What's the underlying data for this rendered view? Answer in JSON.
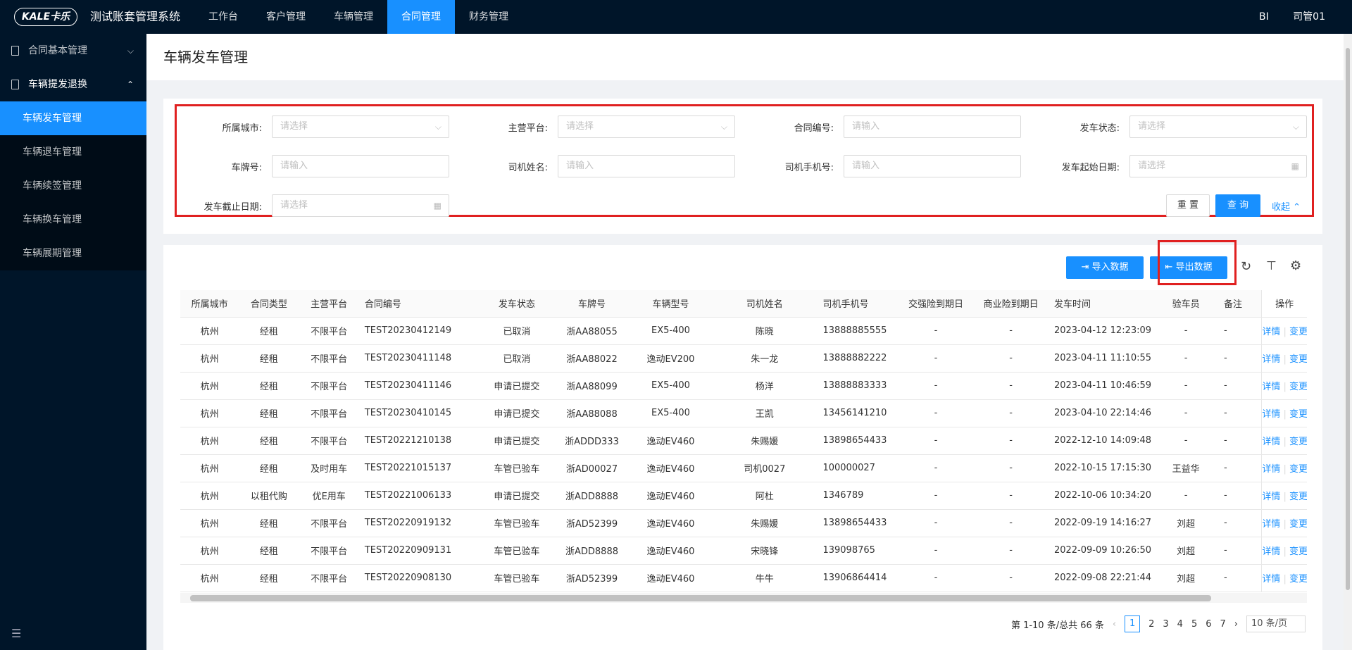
{
  "header": {
    "logo": "KALE卡乐",
    "app_title": "测试账套管理系统",
    "nav": [
      "工作台",
      "客户管理",
      "车辆管理",
      "合同管理",
      "财务管理"
    ],
    "bi": "BI",
    "user": "司管01"
  },
  "sidebar": {
    "group1": "合同基本管理",
    "group2": "车辆提发退换",
    "items": [
      "车辆发车管理",
      "车辆退车管理",
      "车辆续签管理",
      "车辆换车管理",
      "车辆展期管理"
    ]
  },
  "page": {
    "title": "车辆发车管理"
  },
  "filters": {
    "city_label": "所属城市:",
    "city_ph": "请选择",
    "platform_label": "主营平台:",
    "platform_ph": "请选择",
    "contract_label": "合同编号:",
    "contract_ph": "请输入",
    "status_label": "发车状态:",
    "status_ph": "请选择",
    "plate_label": "车牌号:",
    "plate_ph": "请输入",
    "driver_label": "司机姓名:",
    "driver_ph": "请输入",
    "phone_label": "司机手机号:",
    "phone_ph": "请输入",
    "start_label": "发车起始日期:",
    "start_ph": "请选择",
    "end_label": "发车截止日期:",
    "end_ph": "请选择",
    "reset": "重 置",
    "query": "查 询",
    "collapse": "收起"
  },
  "toolbar": {
    "import": "导入数据",
    "export": "导出数据"
  },
  "table": {
    "headers": [
      "所属城市",
      "合同类型",
      "主营平台",
      "合同编号",
      "发车状态",
      "车牌号",
      "车辆型号",
      "司机姓名",
      "司机手机号",
      "交强险到期日",
      "商业险到期日",
      "发车时间",
      "验车员",
      "备注",
      "操作"
    ],
    "rows": [
      [
        "杭州",
        "经租",
        "不限平台",
        "TEST20230412149",
        "已取消",
        "浙AA88055",
        "EX5-400",
        "陈晓",
        "13888885555",
        "-",
        "-",
        "2023-04-12 12:23:09",
        "-",
        "-"
      ],
      [
        "杭州",
        "经租",
        "不限平台",
        "TEST20230411148",
        "已取消",
        "浙AA88022",
        "逸动EV200",
        "朱一龙",
        "13888882222",
        "-",
        "-",
        "2023-04-11 11:10:55",
        "-",
        "-"
      ],
      [
        "杭州",
        "经租",
        "不限平台",
        "TEST20230411146",
        "申请已提交",
        "浙AA88099",
        "EX5-400",
        "杨洋",
        "13888883333",
        "-",
        "-",
        "2023-04-11 10:46:59",
        "-",
        "-"
      ],
      [
        "杭州",
        "经租",
        "不限平台",
        "TEST20230410145",
        "申请已提交",
        "浙AA88088",
        "EX5-400",
        "王凯",
        "13456141210",
        "-",
        "-",
        "2023-04-10 22:14:46",
        "-",
        "-"
      ],
      [
        "杭州",
        "经租",
        "不限平台",
        "TEST20221210138",
        "申请已提交",
        "浙ADDD333",
        "逸动EV460",
        "朱赐媛",
        "13898654433",
        "-",
        "-",
        "2022-12-10 14:09:48",
        "-",
        "-"
      ],
      [
        "杭州",
        "经租",
        "及时用车",
        "TEST20221015137",
        "车管已验车",
        "浙AD00027",
        "逸动EV460",
        "司机0027",
        "100000027",
        "-",
        "-",
        "2022-10-15 17:15:30",
        "王益华",
        "-"
      ],
      [
        "杭州",
        "以租代购",
        "优E用车",
        "TEST20221006133",
        "申请已提交",
        "浙ADD8888",
        "逸动EV460",
        "阿杜",
        "1346789",
        "-",
        "-",
        "2022-10-06 10:34:20",
        "-",
        "-"
      ],
      [
        "杭州",
        "经租",
        "不限平台",
        "TEST20220919132",
        "车管已验车",
        "浙AD52399",
        "逸动EV460",
        "朱赐媛",
        "13898654433",
        "-",
        "-",
        "2022-09-19 14:16:27",
        "刘超",
        "-"
      ],
      [
        "杭州",
        "经租",
        "不限平台",
        "TEST20220909131",
        "车管已验车",
        "浙ADD8888",
        "逸动EV460",
        "宋晓锋",
        "139098765",
        "-",
        "-",
        "2022-09-09 10:26:50",
        "刘超",
        "-"
      ],
      [
        "杭州",
        "经租",
        "不限平台",
        "TEST20220908130",
        "车管已验车",
        "浙AD52399",
        "逸动EV460",
        "牛牛",
        "13906864414",
        "-",
        "-",
        "2022-09-08 22:21:44",
        "刘超",
        "-"
      ]
    ],
    "op_detail": "详情",
    "op_change": "变更"
  },
  "pagination": {
    "summary": "第 1-10 条/总共 66 条",
    "pages": [
      "1",
      "2",
      "3",
      "4",
      "5",
      "6",
      "7"
    ],
    "size": "10 条/页"
  }
}
